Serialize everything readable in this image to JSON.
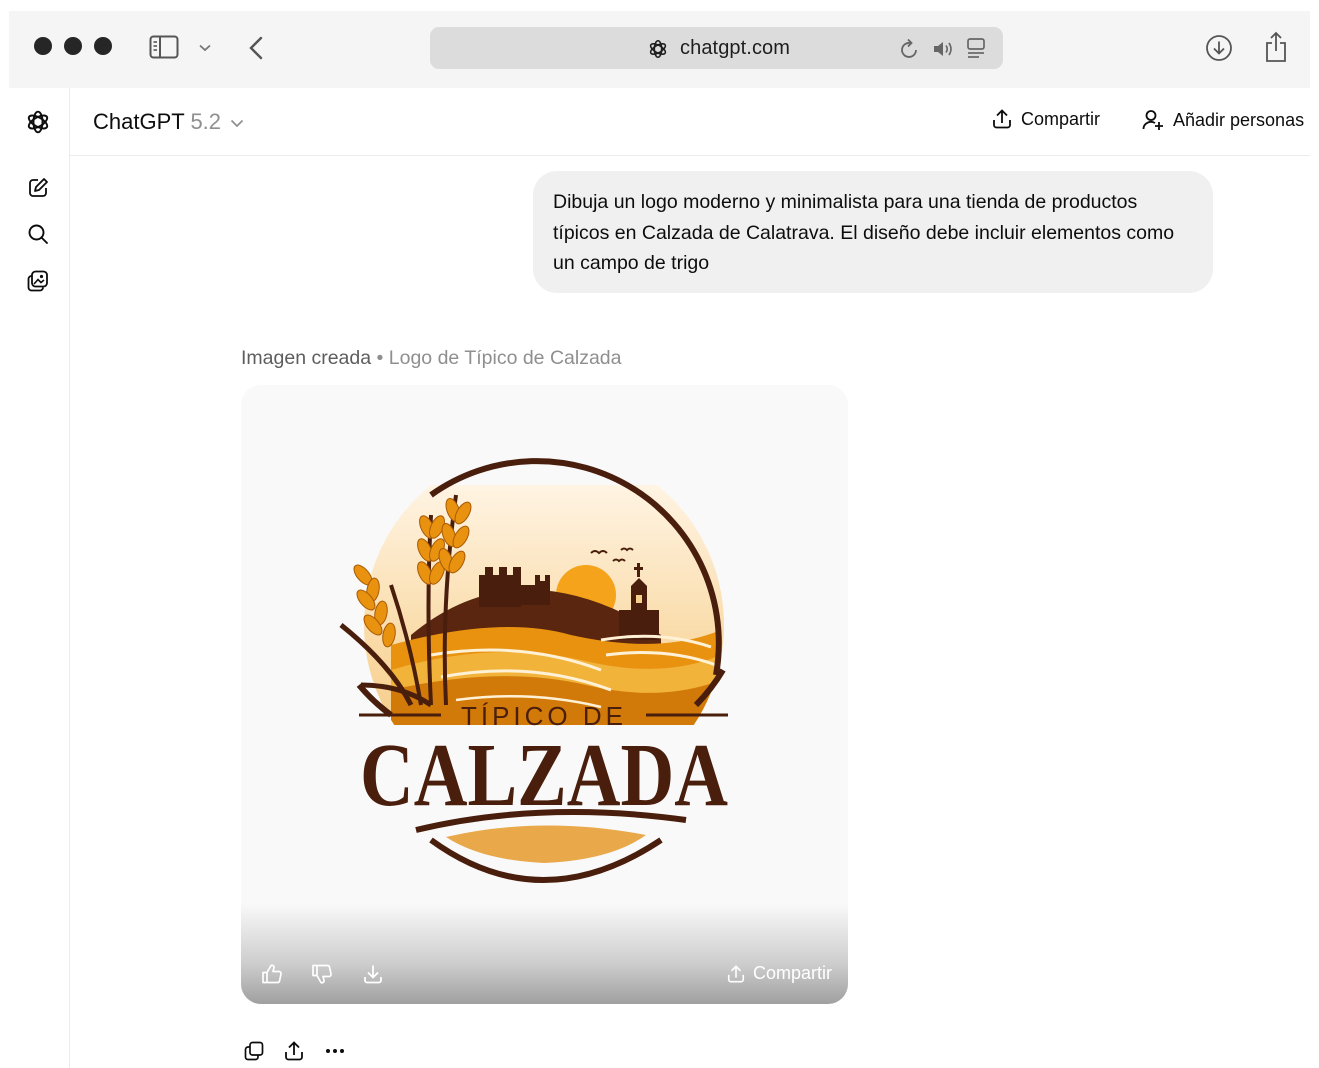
{
  "browser": {
    "url": "chatgpt.com",
    "icons": [
      "sidebar-toggle-icon",
      "chevron-down-icon",
      "back-icon",
      "site-icon",
      "reload-icon",
      "speaker-icon",
      "reader-icon",
      "download-icon",
      "share-icon"
    ]
  },
  "header": {
    "model_name": "ChatGPT",
    "model_version": "5.2",
    "share_label": "Compartir",
    "add_people_label": "Añadir personas"
  },
  "sidebar": {
    "icons": [
      "openai-logo-icon",
      "new-chat-icon",
      "search-icon",
      "library-icon"
    ]
  },
  "chat": {
    "user_message": "Dibuja un logo moderno y minimalista para una tienda de productos típicos en Calzada de Calatrava. El diseño debe incluir elementos como un campo de trigo",
    "image_caption_label": "Imagen creada",
    "image_caption_separator": "•",
    "image_caption_title": "Logo de Típico de Calzada",
    "image_overlay": {
      "share_label": "Compartir",
      "icons": [
        "thumbs-up-icon",
        "thumbs-down-icon",
        "download-icon",
        "share-icon"
      ]
    },
    "message_action_icons": [
      "copy-icon",
      "share-icon",
      "more-icon"
    ]
  },
  "logo": {
    "top_text": "TÍPICO DE",
    "main_text": "CALZADA"
  },
  "colors": {
    "logo_brown": "#4a1e0c",
    "logo_orange": "#e8920f",
    "logo_gold": "#f2b33a",
    "sky": "#fbe6c4"
  }
}
